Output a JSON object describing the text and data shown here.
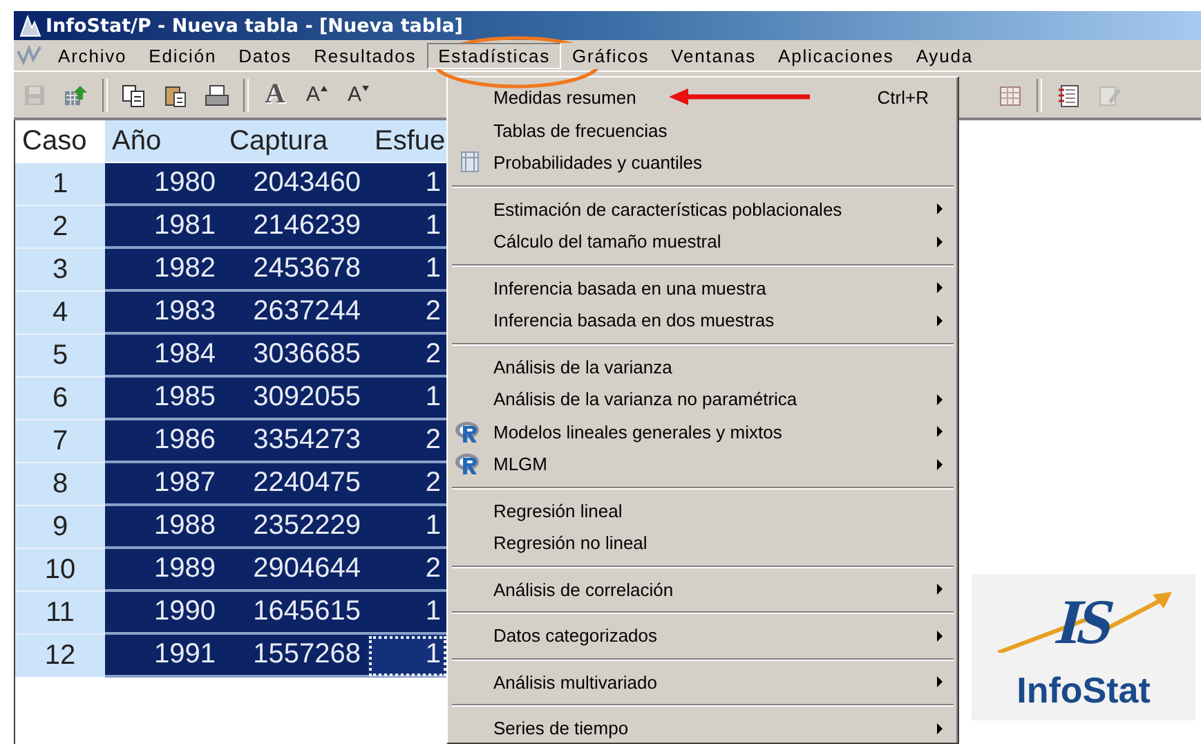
{
  "window": {
    "title": "InfoStat/P - Nueva tabla - [Nueva tabla]"
  },
  "menu_bar": [
    {
      "label": "Archivo",
      "selected": false
    },
    {
      "label": "Edición",
      "selected": false
    },
    {
      "label": "Datos",
      "selected": false
    },
    {
      "label": "Resultados",
      "selected": false
    },
    {
      "label": "Estadísticas",
      "selected": true
    },
    {
      "label": "Gráficos",
      "selected": false
    },
    {
      "label": "Ventanas",
      "selected": false
    },
    {
      "label": "Aplicaciones",
      "selected": false
    },
    {
      "label": "Ayuda",
      "selected": false
    }
  ],
  "toolbar_left": [
    {
      "kind": "save",
      "disabled": true
    },
    {
      "kind": "export",
      "disabled": false
    },
    {
      "kind": "separator"
    },
    {
      "kind": "copy",
      "disabled": false
    },
    {
      "kind": "paste",
      "disabled": false
    },
    {
      "kind": "print",
      "disabled": false
    },
    {
      "kind": "separator"
    },
    {
      "kind": "font",
      "label": "A",
      "disabled": false
    },
    {
      "kind": "font-grow",
      "label": "A",
      "disabled": false
    },
    {
      "kind": "font-shrink",
      "label": "A",
      "disabled": false
    }
  ],
  "toolbar_right": [
    {
      "kind": "table",
      "disabled": false
    },
    {
      "kind": "separator"
    },
    {
      "kind": "notebook",
      "disabled": false
    },
    {
      "kind": "edit",
      "disabled": true
    }
  ],
  "table": {
    "columns": [
      "Caso",
      "Año",
      "Captura",
      "Esfue"
    ],
    "rows": [
      {
        "cells": [
          "1",
          "1980",
          "2043460",
          "1"
        ],
        "selected": true,
        "focused": false
      },
      {
        "cells": [
          "2",
          "1981",
          "2146239",
          "1"
        ],
        "selected": true,
        "focused": false
      },
      {
        "cells": [
          "3",
          "1982",
          "2453678",
          "1"
        ],
        "selected": true,
        "focused": false
      },
      {
        "cells": [
          "4",
          "1983",
          "2637244",
          "2"
        ],
        "selected": true,
        "focused": false
      },
      {
        "cells": [
          "5",
          "1984",
          "3036685",
          "2"
        ],
        "selected": true,
        "focused": false
      },
      {
        "cells": [
          "6",
          "1985",
          "3092055",
          "1"
        ],
        "selected": true,
        "focused": false
      },
      {
        "cells": [
          "7",
          "1986",
          "3354273",
          "2"
        ],
        "selected": true,
        "focused": false
      },
      {
        "cells": [
          "8",
          "1987",
          "2240475",
          "2"
        ],
        "selected": true,
        "focused": false
      },
      {
        "cells": [
          "9",
          "1988",
          "2352229",
          "1"
        ],
        "selected": true,
        "focused": false
      },
      {
        "cells": [
          "10",
          "1989",
          "2904644",
          "2"
        ],
        "selected": true,
        "focused": false
      },
      {
        "cells": [
          "11",
          "1990",
          "1645615",
          "1"
        ],
        "selected": true,
        "focused": false
      },
      {
        "cells": [
          "12",
          "1991",
          "1557268",
          "1"
        ],
        "selected": true,
        "focused": true
      }
    ]
  },
  "dropdown": {
    "groups": [
      [
        {
          "label": "Medidas resumen",
          "shortcut": "Ctrl+R",
          "submenu": false
        },
        {
          "label": "Tablas de frecuencias",
          "submenu": false
        },
        {
          "label": "Probabilidades y cuantiles",
          "submenu": false,
          "kind": "table"
        }
      ],
      [
        {
          "label": "Estimación de características poblacionales",
          "submenu": true
        },
        {
          "label": "Cálculo del tamaño muestral",
          "submenu": true
        }
      ],
      [
        {
          "label": "Inferencia basada en una muestra",
          "submenu": true
        },
        {
          "label": "Inferencia basada en dos muestras",
          "submenu": true
        }
      ],
      [
        {
          "label": "Análisis de la varianza",
          "submenu": false
        },
        {
          "label": "Análisis de la varianza no paramétrica",
          "submenu": true
        },
        {
          "label": "Modelos lineales generales y mixtos",
          "submenu": true,
          "kind": "r"
        },
        {
          "label": "MLGM",
          "submenu": true,
          "kind": "r"
        }
      ],
      [
        {
          "label": "Regresión lineal",
          "submenu": false
        },
        {
          "label": "Regresión no lineal",
          "submenu": false
        }
      ],
      [
        {
          "label": "Análisis de correlación",
          "submenu": true
        }
      ],
      [
        {
          "label": "Datos categorizados",
          "submenu": true
        }
      ],
      [
        {
          "label": "Análisis multivariado",
          "submenu": true
        }
      ],
      [
        {
          "label": "Series de tiempo",
          "submenu": true
        }
      ]
    ]
  },
  "logo": {
    "mark": "IS",
    "name": "InfoStat"
  }
}
